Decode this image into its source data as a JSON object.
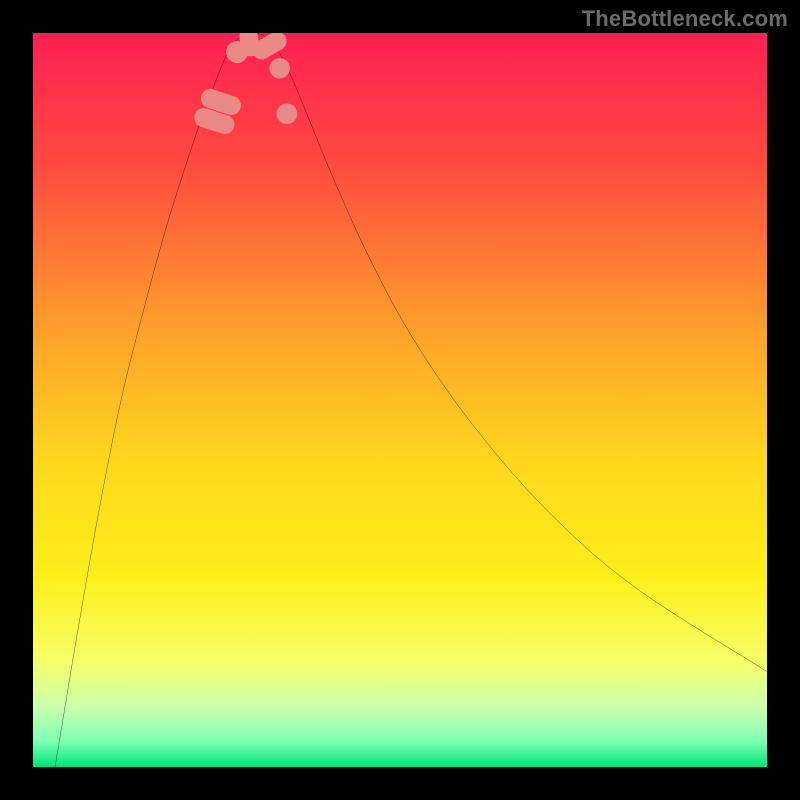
{
  "watermark": "TheBottleneck.com",
  "chart_data": {
    "type": "line",
    "title": "",
    "xlabel": "",
    "ylabel": "",
    "xlim": [
      0,
      100
    ],
    "ylim": [
      0,
      100
    ],
    "grid": false,
    "legend": false,
    "background_gradient_stops": [
      {
        "offset": 0.0,
        "color": "#ff1f53"
      },
      {
        "offset": 0.18,
        "color": "#ff4a3f"
      },
      {
        "offset": 0.4,
        "color": "#ff9e2b"
      },
      {
        "offset": 0.58,
        "color": "#ffd61e"
      },
      {
        "offset": 0.74,
        "color": "#ffee1a"
      },
      {
        "offset": 0.86,
        "color": "#f4ff6b"
      },
      {
        "offset": 0.92,
        "color": "#c9ffb0"
      },
      {
        "offset": 0.965,
        "color": "#7dffb4"
      },
      {
        "offset": 1.0,
        "color": "#00e37a"
      }
    ],
    "green_band": {
      "y_top": 96.3,
      "y_bottom": 100,
      "color": "#00e37a"
    },
    "series": [
      {
        "name": "bottleneck-curve",
        "color": "#000000",
        "width": 2,
        "points": [
          {
            "x": 3.0,
            "y": 0.0
          },
          {
            "x": 4.0,
            "y": 6.0
          },
          {
            "x": 6.0,
            "y": 18.0
          },
          {
            "x": 9.0,
            "y": 35.0
          },
          {
            "x": 12.0,
            "y": 50.0
          },
          {
            "x": 15.0,
            "y": 62.0
          },
          {
            "x": 18.0,
            "y": 73.0
          },
          {
            "x": 20.5,
            "y": 81.0
          },
          {
            "x": 22.5,
            "y": 87.0
          },
          {
            "x": 24.0,
            "y": 91.0
          },
          {
            "x": 25.5,
            "y": 95.0
          },
          {
            "x": 27.0,
            "y": 98.2
          },
          {
            "x": 28.5,
            "y": 99.6
          },
          {
            "x": 30.0,
            "y": 100.0
          },
          {
            "x": 31.5,
            "y": 99.6
          },
          {
            "x": 33.0,
            "y": 98.2
          },
          {
            "x": 35.0,
            "y": 94.5
          },
          {
            "x": 37.5,
            "y": 88.5
          },
          {
            "x": 41.0,
            "y": 80.0
          },
          {
            "x": 46.0,
            "y": 69.0
          },
          {
            "x": 52.0,
            "y": 58.0
          },
          {
            "x": 60.0,
            "y": 46.5
          },
          {
            "x": 70.0,
            "y": 35.0
          },
          {
            "x": 82.0,
            "y": 24.5
          },
          {
            "x": 100.0,
            "y": 13.0
          }
        ]
      }
    ],
    "markers": [
      {
        "shape": "capsule",
        "cx": 24.7,
        "cy": 88.0,
        "w": 2.6,
        "h": 5.6,
        "angle": -72,
        "color": "#e98a86"
      },
      {
        "shape": "capsule",
        "cx": 25.6,
        "cy": 90.6,
        "w": 2.6,
        "h": 5.6,
        "angle": -72,
        "color": "#e98a86"
      },
      {
        "shape": "circle",
        "cx": 27.8,
        "cy": 97.4,
        "r": 1.5,
        "color": "#e98a86"
      },
      {
        "shape": "capsule",
        "cx": 29.5,
        "cy": 98.8,
        "w": 2.5,
        "h": 4.0,
        "angle": -10,
        "color": "#e98a86"
      },
      {
        "shape": "capsule",
        "cx": 32.2,
        "cy": 98.3,
        "w": 2.6,
        "h": 5.0,
        "angle": 60,
        "color": "#e98a86"
      },
      {
        "shape": "circle",
        "cx": 33.6,
        "cy": 95.2,
        "r": 1.4,
        "color": "#e98a86"
      },
      {
        "shape": "circle",
        "cx": 34.6,
        "cy": 89.0,
        "r": 1.4,
        "color": "#e98a86"
      }
    ]
  }
}
